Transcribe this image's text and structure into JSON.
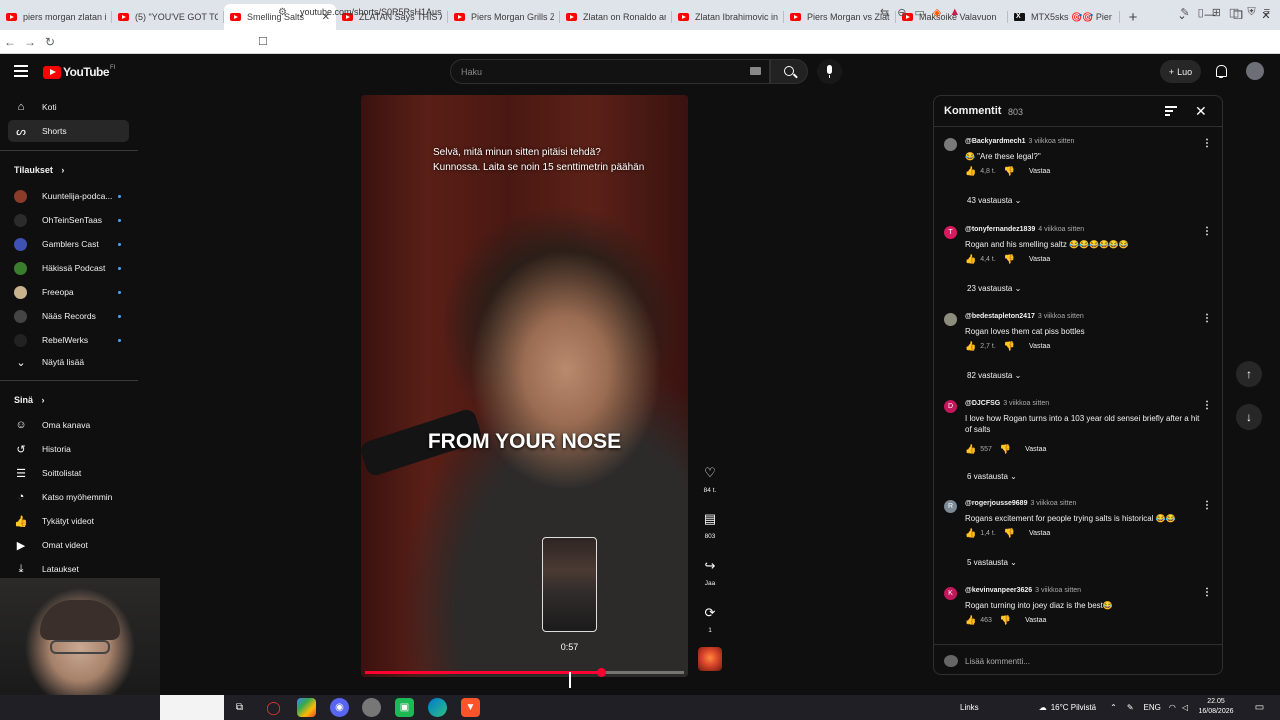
{
  "browser": {
    "tabs": [
      {
        "label": "piers morgan zlatan ib",
        "icon": "youtube-icon",
        "active": false
      },
      {
        "label": "(5) \"YOU'VE GOT TO B",
        "icon": "youtube-icon",
        "active": false
      },
      {
        "label": "Smelling Salts",
        "icon": "youtube-icon",
        "active": true
      },
      {
        "label": "ZLATAN Says THIS Ab",
        "icon": "youtube-icon",
        "active": false
      },
      {
        "label": "Piers Morgan Grills Zl",
        "icon": "youtube-icon",
        "active": false
      },
      {
        "label": "Zlatan on Ronaldo an",
        "icon": "youtube-icon",
        "active": false
      },
      {
        "label": "Zlatan Ibrahimovic in",
        "icon": "youtube-icon",
        "active": false
      },
      {
        "label": "Piers Morgan vs Zlat",
        "icon": "youtube-icon",
        "active": false
      },
      {
        "label": "Maksoike Valavuon",
        "icon": "youtube-icon",
        "active": false
      },
      {
        "label": "MTX5sks 🎯🎯 Pier",
        "icon": "x-icon",
        "active": false
      }
    ],
    "url": "youtube.com/shorts/S0R5RsH1Aus"
  },
  "youtube": {
    "logo_text": "YouTube",
    "logo_country": "FI",
    "search_placeholder": "Haku",
    "create_label": "Luo"
  },
  "sidebar": {
    "home": "Koti",
    "shorts": "Shorts",
    "subs_heading": "Tilaukset",
    "channels": [
      {
        "name": "Kuuntelija-podca...",
        "color": "#8a3b2a"
      },
      {
        "name": "OhTeinSenTaas",
        "color": "#2b2b2b"
      },
      {
        "name": "Gamblers Cast",
        "color": "#3f51b5"
      },
      {
        "name": "Häkissä Podcast",
        "color": "#3a7d2c"
      },
      {
        "name": "Freeopa",
        "color": "#c9b38e"
      },
      {
        "name": "Nääs Records",
        "color": "#444444"
      },
      {
        "name": "RebelWerks",
        "color": "#222222"
      }
    ],
    "show_more": "Näytä lisää",
    "you_heading": "Sinä",
    "you_items": [
      "Oma kanava",
      "Historia",
      "Soittolistat",
      "Katso myöhemmin",
      "Tykätyt videot",
      "Omat videot",
      "Lataukset"
    ]
  },
  "player": {
    "caption_line1": "Selvä, mitä minun sitten pitäisi tehdä?",
    "caption_line2": "Kunnossa.  Laita se noin 15 senttimetrin päähän",
    "caption_big": "FROM YOUR NOSE",
    "preview_time": "0:57",
    "progress": 0.74,
    "likes": "84 t.",
    "comments": "803",
    "share": "Jaa",
    "remix": "1"
  },
  "comments_panel": {
    "title": "Kommentit",
    "count": "803",
    "add_placeholder": "Lisää kommentti...",
    "reply_label": "Vastaa",
    "items": [
      {
        "user": "@Backyardmech1",
        "time": "3 viikkoa sitten",
        "text": "😂 \"Are these legal?\"",
        "likes": "4,8 t.",
        "replies": "43 vastausta",
        "avatar_color": "#7a7a7a",
        "avatar_letter": ""
      },
      {
        "user": "@tonyfernandez1839",
        "time": "4 viikkoa sitten",
        "text": "Rogan and his smelling saltz 😂😂😂😂😂😂",
        "likes": "4,4 t.",
        "replies": "23 vastausta",
        "avatar_color": "#d81b60",
        "avatar_letter": "T"
      },
      {
        "user": "@bedestapleton2417",
        "time": "3 viikkoa sitten",
        "text": "Rogan loves them cat piss bottles",
        "likes": "2,7 t.",
        "replies": "82 vastausta",
        "avatar_color": "#8d8d7d",
        "avatar_letter": ""
      },
      {
        "user": "@DJCFSG",
        "time": "3 viikkoa sitten",
        "text": "I love how Rogan turns into a 103 year old sensei briefly after a hit of salts",
        "likes": "557",
        "replies": "6 vastausta",
        "avatar_color": "#c2185b",
        "avatar_letter": "D"
      },
      {
        "user": "@rogerjousse9689",
        "time": "3 viikkoa sitten",
        "text": "Rogans excitement for people trying salts is historical 😂😂",
        "likes": "1,4 t.",
        "replies": "5 vastausta",
        "avatar_color": "#7b8a94",
        "avatar_letter": "R"
      },
      {
        "user": "@kevinvanpeer3626",
        "time": "3 viikkoa sitten",
        "text": "Rogan turning into joey diaz is the best😂",
        "likes": "463",
        "replies": "",
        "avatar_color": "#c2185b",
        "avatar_letter": "K"
      }
    ]
  },
  "taskbar": {
    "links": "Links",
    "weather": "16°C Pilvistä",
    "lang": "ENG",
    "time": "22.05",
    "date": "16/08/2026"
  }
}
